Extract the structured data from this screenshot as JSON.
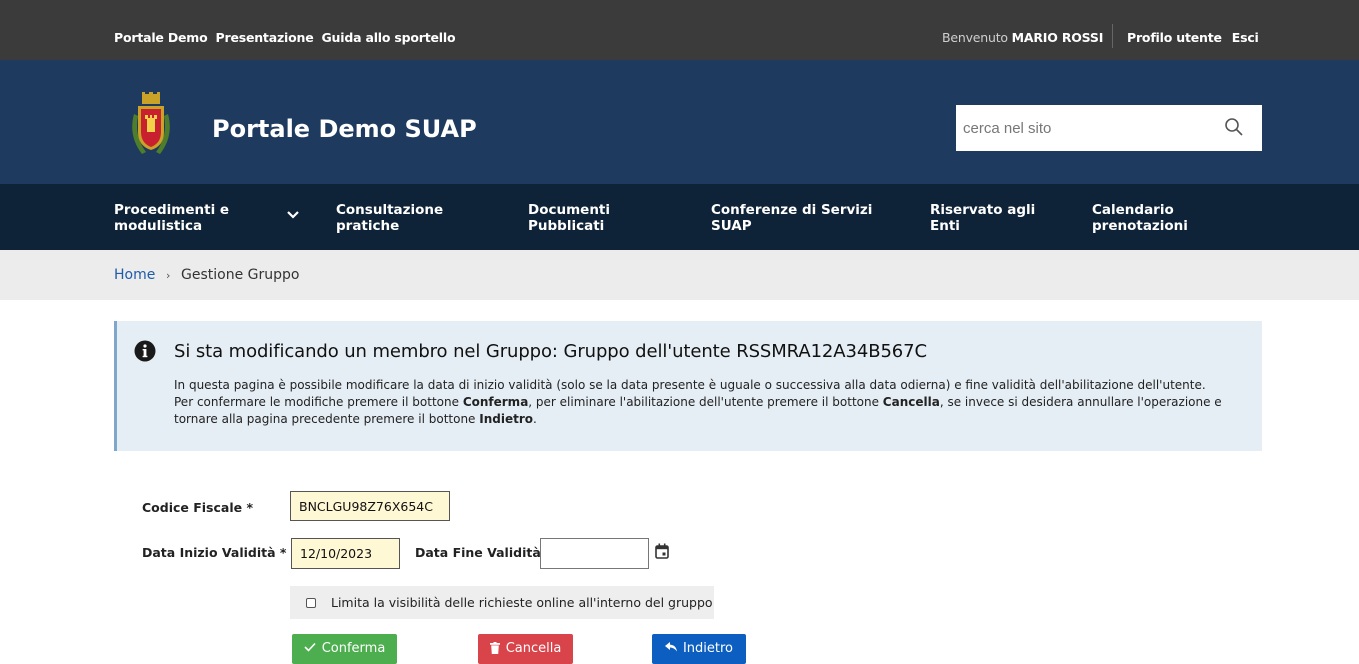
{
  "topbar": {
    "links": [
      "Portale Demo",
      "Presentazione",
      "Guida allo sportello"
    ],
    "welcome_prefix": "Benvenuto",
    "user_name": "MARIO ROSSI",
    "profile_link": "Profilo utente",
    "logout_link": "Esci"
  },
  "header": {
    "site_title": "Portale Demo SUAP",
    "search_placeholder": "cerca nel sito"
  },
  "nav": {
    "items": [
      {
        "line1": "Procedimenti e",
        "line2": "modulistica"
      },
      {
        "line1": "Consultazione",
        "line2": "pratiche"
      },
      {
        "line1": "Documenti",
        "line2": "Pubblicati"
      },
      {
        "line1": "Conferenze di Servizi",
        "line2": "SUAP"
      },
      {
        "line1": "Riservato agli",
        "line2": "Enti"
      },
      {
        "line1": "Calendario",
        "line2": "prenotazioni"
      }
    ]
  },
  "breadcrumb": {
    "home": "Home",
    "separator": "›",
    "current": "Gestione Gruppo"
  },
  "info": {
    "title": "Si sta modificando un membro nel Gruppo: Gruppo dell'utente RSSMRA12A34B567C",
    "line1": "In questa pagina è possibile modificare la data di inizio validità (solo se la data presente è uguale o successiva alla data odierna) e fine validità dell'abilitazione dell'utente.",
    "line2_a": "Per confermare le modifiche premere il bottone ",
    "line2_b": "Conferma",
    "line2_c": ", per eliminare l'abilitazione dell'utente premere il bottone ",
    "line2_d": "Cancella",
    "line2_e": ", se invece si desidera annullare l'operazione e",
    "line3_a": "tornare alla pagina precedente premere il bottone ",
    "line3_b": "Indietro",
    "line3_c": "."
  },
  "form": {
    "codice_fiscale_label": "Codice Fiscale *",
    "codice_fiscale_value": "BNCLGU98Z76X654C",
    "data_inizio_label": "Data Inizio Validità *",
    "data_inizio_value": "12/10/2023",
    "data_fine_label": "Data Fine Validità",
    "data_fine_value": "",
    "checkbox_label": "Limita la visibilità delle richieste online all'interno del gruppo",
    "checkbox_checked": false
  },
  "buttons": {
    "confirm": "Conferma",
    "delete": "Cancella",
    "back": "Indietro"
  },
  "colors": {
    "topbar": "#3b3b3b",
    "header": "#1f3a5f",
    "nav": "#0f2338",
    "confirm": "#4cae4f",
    "delete": "#d9434a",
    "back": "#0c5fc1"
  }
}
